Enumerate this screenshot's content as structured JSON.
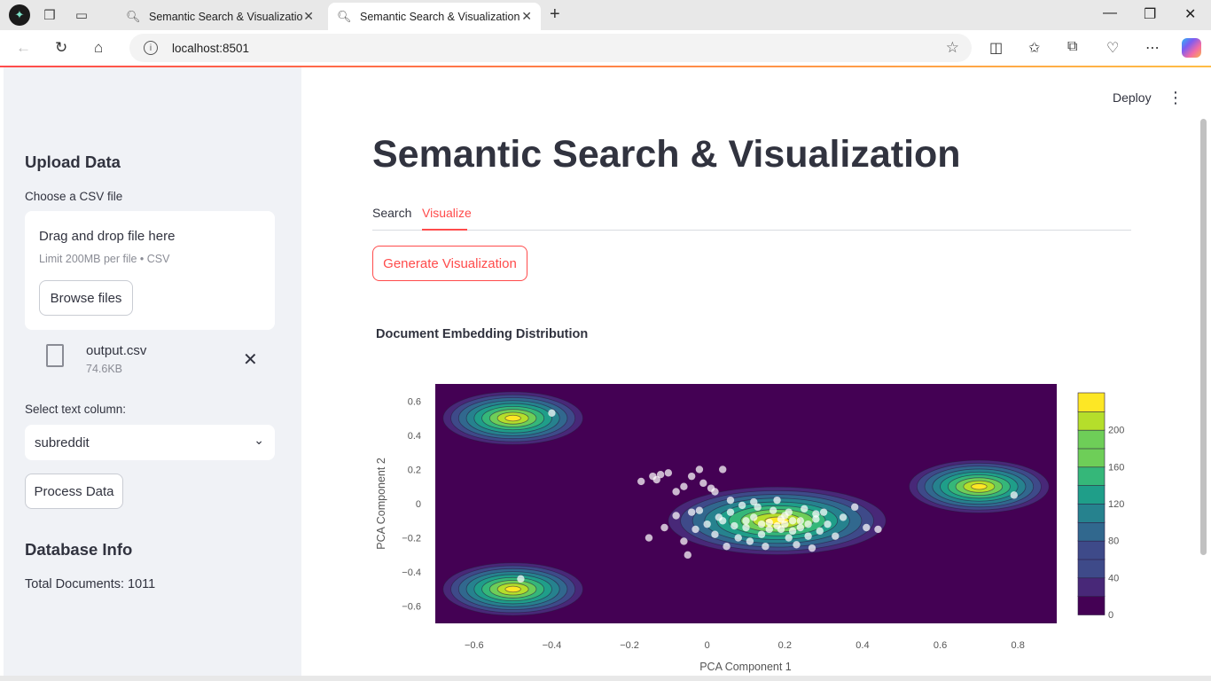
{
  "browser": {
    "tabs": [
      {
        "title": "Semantic Search & Visualization",
        "active": false
      },
      {
        "title": "Semantic Search & Visualization",
        "active": true
      }
    ],
    "url": "localhost:8501"
  },
  "sidebar": {
    "upload_heading": "Upload Data",
    "choose_label": "Choose a CSV file",
    "dropzone_text": "Drag and drop file here",
    "limit_text": "Limit 200MB per file • CSV",
    "browse_label": "Browse files",
    "file_name": "output.csv",
    "file_size": "74.6KB",
    "select_label": "Select text column:",
    "select_value": "subreddit",
    "process_label": "Process Data",
    "db_heading": "Database Info",
    "total_docs": "Total Documents: 1011"
  },
  "main": {
    "deploy_label": "Deploy",
    "title": "Semantic Search & Visualization",
    "tabs": [
      {
        "label": "Search"
      },
      {
        "label": "Visualize"
      }
    ],
    "generate_label": "Generate Visualization",
    "chart_title": "Document Embedding Distribution"
  },
  "colors": {
    "accent": "#ff4b4b",
    "sidebar_bg": "#f0f2f6",
    "text": "#31333f"
  },
  "chart_data": {
    "type": "heatmap",
    "title": "Document Embedding Distribution",
    "xlabel": "PCA Component 1",
    "ylabel": "PCA Component 2",
    "xlim": [
      -0.7,
      0.9
    ],
    "ylim": [
      -0.7,
      0.7
    ],
    "x_ticks": [
      -0.6,
      -0.4,
      -0.2,
      0,
      0.2,
      0.4,
      0.6,
      0.8
    ],
    "y_ticks": [
      -0.6,
      -0.4,
      -0.2,
      0,
      0.2,
      0.4,
      0.6
    ],
    "colorbar_ticks": [
      0,
      40,
      80,
      120,
      160,
      200
    ],
    "colorbar_range": [
      0,
      240
    ],
    "colorscale": "viridis",
    "density_peaks": [
      {
        "x": -0.5,
        "y": 0.5,
        "sx": 0.18,
        "sy": 0.07
      },
      {
        "x": -0.5,
        "y": -0.5,
        "sx": 0.18,
        "sy": 0.07
      },
      {
        "x": 0.7,
        "y": 0.1,
        "sx": 0.18,
        "sy": 0.07
      },
      {
        "x": 0.18,
        "y": -0.1,
        "sx": 0.28,
        "sy": 0.09
      }
    ],
    "points": [
      [
        -0.4,
        0.53
      ],
      [
        -0.48,
        -0.44
      ],
      [
        0.79,
        0.05
      ],
      [
        -0.17,
        0.13
      ],
      [
        -0.14,
        0.16
      ],
      [
        -0.13,
        0.14
      ],
      [
        -0.12,
        0.17
      ],
      [
        -0.1,
        0.18
      ],
      [
        -0.08,
        0.07
      ],
      [
        -0.04,
        0.16
      ],
      [
        -0.02,
        0.2
      ],
      [
        -0.01,
        0.12
      ],
      [
        0.01,
        0.09
      ],
      [
        0.04,
        0.2
      ],
      [
        0.02,
        0.07
      ],
      [
        0.06,
        0.02
      ],
      [
        -0.06,
        0.1
      ],
      [
        -0.04,
        -0.05
      ],
      [
        -0.08,
        -0.07
      ],
      [
        -0.11,
        -0.14
      ],
      [
        -0.15,
        -0.2
      ],
      [
        -0.06,
        -0.22
      ],
      [
        -0.05,
        -0.3
      ],
      [
        -0.03,
        -0.15
      ],
      [
        -0.02,
        -0.04
      ],
      [
        0.0,
        -0.12
      ],
      [
        0.02,
        -0.18
      ],
      [
        0.04,
        -0.1
      ],
      [
        0.06,
        -0.05
      ],
      [
        0.08,
        -0.2
      ],
      [
        0.1,
        -0.14
      ],
      [
        0.12,
        -0.08
      ],
      [
        0.13,
        -0.02
      ],
      [
        0.14,
        -0.18
      ],
      [
        0.16,
        -0.11
      ],
      [
        0.17,
        -0.04
      ],
      [
        0.19,
        -0.15
      ],
      [
        0.2,
        -0.07
      ],
      [
        0.21,
        -0.2
      ],
      [
        0.22,
        -0.1
      ],
      [
        0.24,
        -0.14
      ],
      [
        0.25,
        -0.03
      ],
      [
        0.26,
        -0.19
      ],
      [
        0.28,
        -0.09
      ],
      [
        0.29,
        -0.16
      ],
      [
        0.3,
        -0.05
      ],
      [
        0.31,
        -0.12
      ],
      [
        0.33,
        -0.19
      ],
      [
        0.35,
        -0.08
      ],
      [
        0.38,
        -0.02
      ],
      [
        0.41,
        -0.14
      ],
      [
        0.44,
        -0.15
      ],
      [
        0.11,
        -0.22
      ],
      [
        0.09,
        -0.01
      ],
      [
        0.07,
        -0.13
      ],
      [
        0.15,
        -0.25
      ],
      [
        0.23,
        -0.24
      ],
      [
        0.27,
        -0.26
      ],
      [
        0.18,
        0.02
      ],
      [
        0.12,
        0.01
      ],
      [
        0.05,
        -0.25
      ],
      [
        0.03,
        -0.08
      ],
      [
        0.14,
        -0.12
      ],
      [
        0.18,
        -0.13
      ],
      [
        0.2,
        -0.12
      ],
      [
        0.22,
        -0.16
      ],
      [
        0.16,
        -0.15
      ],
      [
        0.24,
        -0.1
      ],
      [
        0.26,
        -0.12
      ],
      [
        0.1,
        -0.1
      ],
      [
        0.28,
        -0.06
      ],
      [
        0.19,
        -0.09
      ],
      [
        0.21,
        -0.05
      ]
    ]
  }
}
